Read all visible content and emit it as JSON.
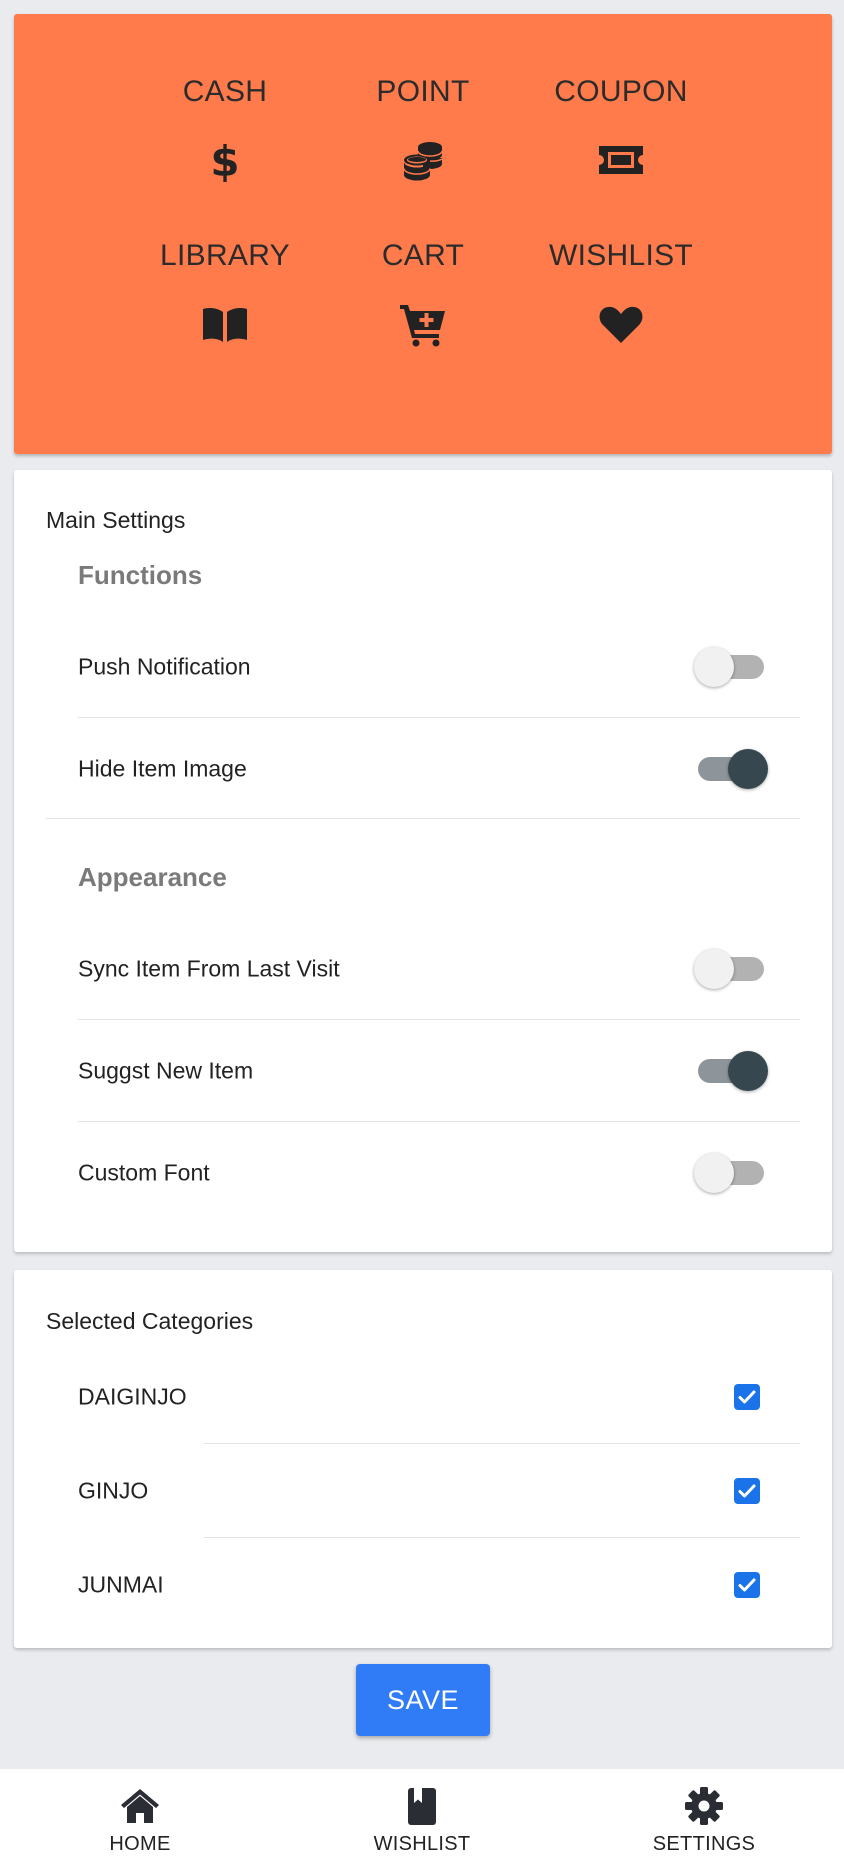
{
  "header": {
    "items": [
      {
        "label": "CASH",
        "icon": "dollar-icon"
      },
      {
        "label": "POINT",
        "icon": "coins-icon"
      },
      {
        "label": "COUPON",
        "icon": "ticket-icon"
      },
      {
        "label": "LIBRARY",
        "icon": "book-open-icon"
      },
      {
        "label": "CART",
        "icon": "cart-plus-icon"
      },
      {
        "label": "WISHLIST",
        "icon": "heart-icon"
      }
    ],
    "color": "#ff7b4b"
  },
  "main_settings": {
    "title": "Main Settings",
    "functions": {
      "title": "Functions",
      "items": [
        {
          "label": "Push Notification",
          "on": false
        },
        {
          "label": "Hide Item Image",
          "on": true
        }
      ]
    },
    "appearance": {
      "title": "Appearance",
      "items": [
        {
          "label": "Sync Item From Last Visit",
          "on": false
        },
        {
          "label": "Suggst New Item",
          "on": true
        },
        {
          "label": "Custom Font",
          "on": false
        }
      ]
    }
  },
  "categories": {
    "title": "Selected Categories",
    "items": [
      {
        "label": "DAIGINJO",
        "checked": true
      },
      {
        "label": "GINJO",
        "checked": true
      },
      {
        "label": "JUNMAI",
        "checked": true
      }
    ]
  },
  "save_label": "SAVE",
  "bottom_nav": {
    "items": [
      {
        "label": "HOME",
        "icon": "home-icon"
      },
      {
        "label": "WISHLIST",
        "icon": "bookmark-book-icon"
      },
      {
        "label": "SETTINGS",
        "icon": "gear-icon"
      }
    ]
  },
  "colors": {
    "accent": "#2f7cf6",
    "toggle_on_knob": "#37474f",
    "background": "#e9ebee"
  }
}
